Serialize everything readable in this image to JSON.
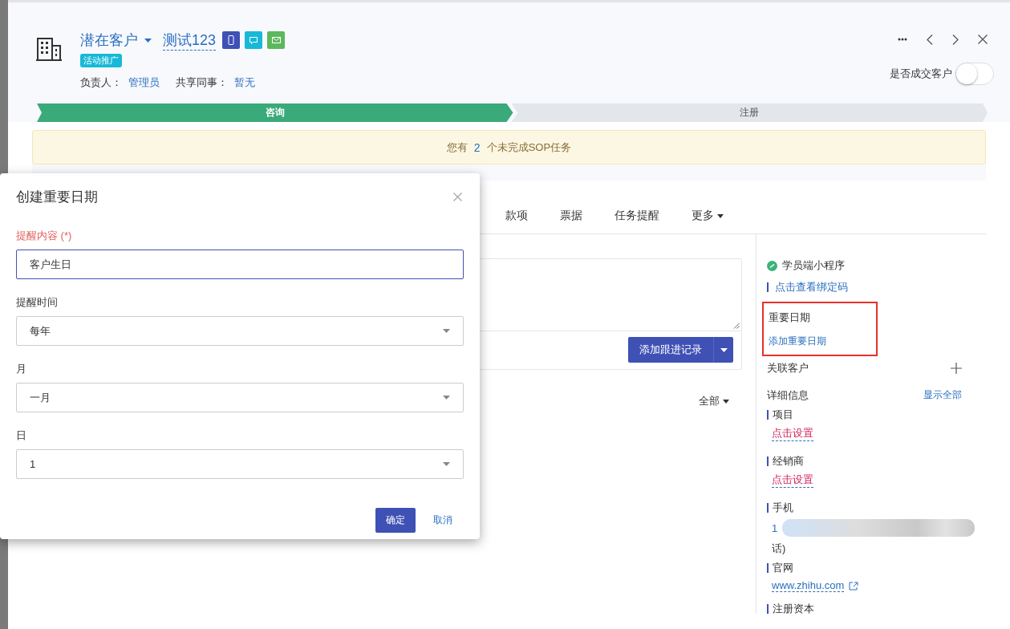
{
  "header": {
    "stage_select": "潜在客户",
    "customer_name": "测试123",
    "contact_actions": [
      {
        "kind": "phone"
      },
      {
        "kind": "sms"
      },
      {
        "kind": "email"
      }
    ],
    "tag": "活动推广",
    "owner_label": "负责人：",
    "owner": "管理员",
    "share_label": "共享同事：",
    "share": "暂无"
  },
  "deal_toggle": {
    "label": "是否成交客户",
    "on": false
  },
  "stages": [
    {
      "label": "咨询",
      "selected": true
    },
    {
      "label": "注册",
      "selected": false
    }
  ],
  "notice": {
    "before": "您有",
    "count": "2",
    "after": "个未完成SOP任务"
  },
  "tabs": [
    {
      "label": "款项",
      "kind": "tab",
      "selected": false
    },
    {
      "label": "票据",
      "kind": "tab",
      "selected": false
    },
    {
      "label": "任务提醒",
      "kind": "tab",
      "selected": false
    },
    {
      "label": "更多",
      "kind": "menu",
      "selected": false
    }
  ],
  "follow_up": {
    "add_button": "添加跟进记录",
    "filter": "全部"
  },
  "sidebar": {
    "mini_program": {
      "title": "学员端小程序",
      "link": "点击查看绑定码"
    },
    "important_dates": {
      "title": "重要日期",
      "link": "添加重要日期",
      "highlighted": true
    },
    "related": {
      "title": "关联客户"
    },
    "details": {
      "title": "详细信息",
      "show_all": "显示全部",
      "fields": [
        {
          "label": "项目",
          "kind": "unset",
          "value": "点击设置"
        },
        {
          "label": "经销商",
          "kind": "unset",
          "value": "点击设置"
        },
        {
          "label": "手机",
          "kind": "redacted",
          "value": "1",
          "extra": "话)"
        },
        {
          "label": "官网",
          "kind": "link",
          "value": "www.zhihu.com"
        },
        {
          "label": "注册资本",
          "kind": "empty"
        }
      ]
    }
  },
  "dialog": {
    "title": "创建重要日期",
    "fields": [
      {
        "label": "提醒内容 (*)",
        "required": true,
        "kind": "input",
        "focused": true,
        "value": "客户生日"
      },
      {
        "label": "提醒时间",
        "required": false,
        "kind": "select",
        "focused": false,
        "value": "每年"
      },
      {
        "label": "月",
        "required": false,
        "kind": "select",
        "focused": false,
        "value": "一月"
      },
      {
        "label": "日",
        "required": false,
        "kind": "select",
        "focused": false,
        "value": "1"
      }
    ],
    "buttons": [
      {
        "label": "确定",
        "kind": "primary"
      },
      {
        "label": "取消",
        "kind": "link"
      }
    ]
  }
}
